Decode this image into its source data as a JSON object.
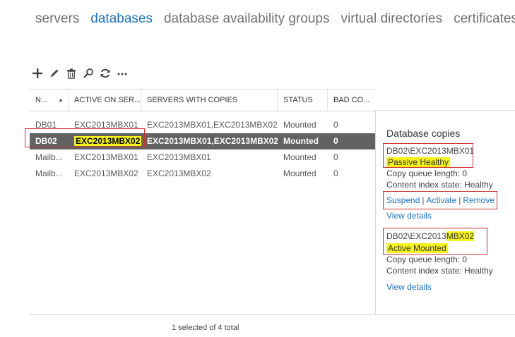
{
  "nav": {
    "tabs": [
      {
        "label": "servers",
        "active": false
      },
      {
        "label": "databases",
        "active": true
      },
      {
        "label": "database availability groups",
        "active": false
      },
      {
        "label": "virtual directories",
        "active": false
      },
      {
        "label": "certificates",
        "active": false
      }
    ]
  },
  "toolbar": {
    "icons": [
      "add-icon",
      "edit-icon",
      "delete-icon",
      "search-icon",
      "refresh-icon",
      "more-icon"
    ]
  },
  "grid": {
    "columns": [
      "N...",
      "ACTIVE ON SER...",
      "SERVERS WITH COPIES",
      "STATUS",
      "BAD CO..."
    ],
    "rows": [
      {
        "name": "DB01",
        "active_on": "EXC2013MBX01",
        "servers": "EXC2013MBX01,EXC2013MBX02",
        "status": "Mounted",
        "bad": "0"
      },
      {
        "name": "DB02",
        "active_on": "EXC2013MBX02",
        "servers": "EXC2013MBX01,EXC2013MBX02",
        "status": "Mounted",
        "bad": "0"
      },
      {
        "name": "Mailb...",
        "active_on": "EXC2013MBX01",
        "servers": "EXC2013MBX01",
        "status": "Mounted",
        "bad": "0"
      },
      {
        "name": "Mailb...",
        "active_on": "EXC2013MBX02",
        "servers": "EXC2013MBX02",
        "status": "Mounted",
        "bad": "0"
      }
    ],
    "selected_index": 1,
    "status_text": "1 selected of 4 total"
  },
  "details": {
    "title": "Database copies",
    "copy1": {
      "name": "DB02\\EXC2013MBX01",
      "state": "Passive Healthy",
      "queue": "Copy queue length:  0",
      "index": "Content index state:  Healthy",
      "actions": [
        "Suspend",
        "Activate",
        "Remove"
      ],
      "view": "View details"
    },
    "copy2": {
      "name_prefix": "DB02\\EXC2013",
      "name_highlight": "MBX02",
      "state": "Active Mounted",
      "queue": "Copy queue length:  0",
      "index": "Content index state:  Healthy",
      "view": "View details"
    }
  },
  "colors": {
    "accent": "#1e73be",
    "highlight": "#f6f31b",
    "selected_row": "#626262",
    "annotation_red": "#d32f2f"
  }
}
